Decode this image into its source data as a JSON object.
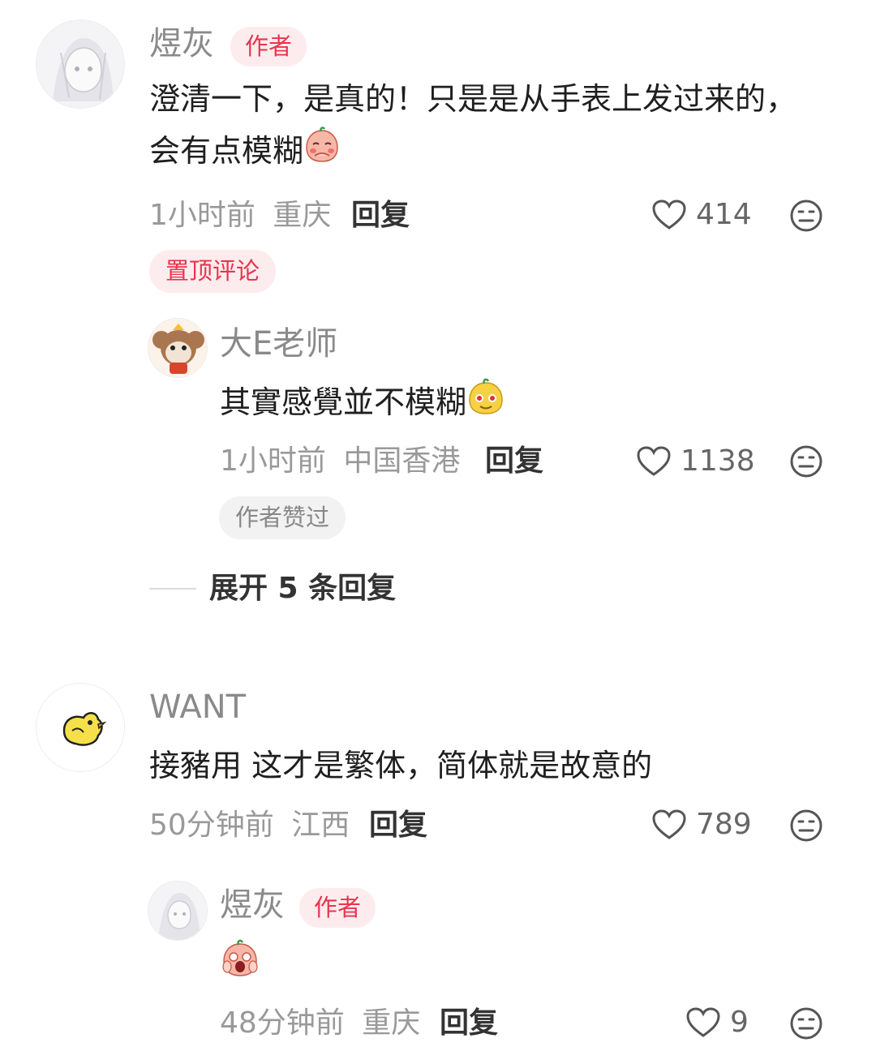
{
  "comments": [
    {
      "username": "煜灰",
      "author_tag": "作者",
      "text": "澄清一下，是真的！只是是从手表上发过来的，会有点模糊",
      "emoji_icon": "shy-peach-emoji-icon",
      "time": "1小时前",
      "location": "重庆",
      "reply_label": "回复",
      "likes": "414",
      "pin_label": "置顶评论",
      "replies": [
        {
          "username": "大E老师",
          "text": "其實感覺並不模糊",
          "emoji_icon": "yellow-smug-emoji-icon",
          "time": "1小时前",
          "location": "中国香港",
          "reply_label": "回复",
          "likes": "1138",
          "liked_by_author_label": "作者赞过"
        }
      ],
      "expand_label": "展开 5 条回复"
    },
    {
      "username": "WANT",
      "text": "接豬用 这才是繁体，简体就是故意的",
      "time": "50分钟前",
      "location": "江西",
      "reply_label": "回复",
      "likes": "789",
      "replies": [
        {
          "username": "煜灰",
          "author_tag": "作者",
          "emoji_icon": "shocked-face-emoji-icon",
          "time": "48分钟前",
          "location": "重庆",
          "reply_label": "回复",
          "likes": "9"
        }
      ]
    }
  ],
  "colors": {
    "accent": "#e8344e",
    "tag_bg": "#fdecee",
    "meta": "#999999"
  }
}
